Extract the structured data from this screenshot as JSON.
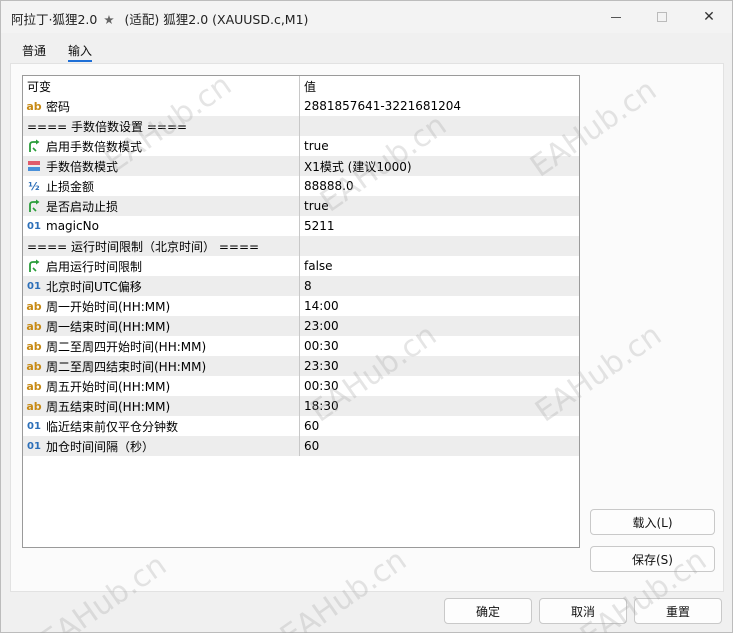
{
  "window": {
    "title_part1": "阿拉丁·狐狸2.0",
    "title_part2": "(适配)  狐狸2.0 (XAUUSD.c,M1)",
    "minimize_label": "—",
    "close_label": "✕"
  },
  "tabs": [
    {
      "label": "普通"
    },
    {
      "label": "输入"
    }
  ],
  "grid": {
    "headers": {
      "name": "可变",
      "value": "值"
    },
    "rows": [
      {
        "icon": "ab",
        "name": "密码",
        "value": "2881857641-3221681204"
      },
      {
        "icon": "none",
        "name": "==== 手数倍数设置 ====",
        "value": ""
      },
      {
        "icon": "bool",
        "name": "启用手数倍数模式",
        "value": "true"
      },
      {
        "icon": "enum",
        "name": "手数倍数模式",
        "value": "X1模式 (建议1000)"
      },
      {
        "icon": "half",
        "name": "止损金额",
        "value": "88888.0"
      },
      {
        "icon": "bool",
        "name": "是否启动止损",
        "value": "true"
      },
      {
        "icon": "01",
        "name": "magicNo",
        "value": "5211"
      },
      {
        "icon": "none",
        "name": "==== 运行时间限制（北京时间） ====",
        "value": ""
      },
      {
        "icon": "bool",
        "name": "启用运行时间限制",
        "value": "false"
      },
      {
        "icon": "01",
        "name": "北京时间UTC偏移",
        "value": "8"
      },
      {
        "icon": "ab",
        "name": "周一开始时间(HH:MM)",
        "value": "14:00"
      },
      {
        "icon": "ab",
        "name": "周一结束时间(HH:MM)",
        "value": "23:00"
      },
      {
        "icon": "ab",
        "name": "周二至周四开始时间(HH:MM)",
        "value": "00:30"
      },
      {
        "icon": "ab",
        "name": "周二至周四结束时间(HH:MM)",
        "value": "23:30"
      },
      {
        "icon": "ab",
        "name": "周五开始时间(HH:MM)",
        "value": "00:30"
      },
      {
        "icon": "ab",
        "name": "周五结束时间(HH:MM)",
        "value": "18:30"
      },
      {
        "icon": "01",
        "name": "临近结束前仅平仓分钟数",
        "value": "60"
      },
      {
        "icon": "01",
        "name": "加仓时间间隔（秒）",
        "value": "60"
      }
    ]
  },
  "buttons": {
    "load": "载入(L)",
    "save": "保存(S)",
    "ok": "确定",
    "cancel": "取消",
    "reset": "重置"
  },
  "watermark": "EAHub.cn",
  "colors": {
    "accent": "#1f6fd6",
    "alt_row": "#ededed",
    "bool_icon": "#2a9d3a",
    "string_icon": "#c78a15",
    "int_icon": "#2d6fb8"
  }
}
